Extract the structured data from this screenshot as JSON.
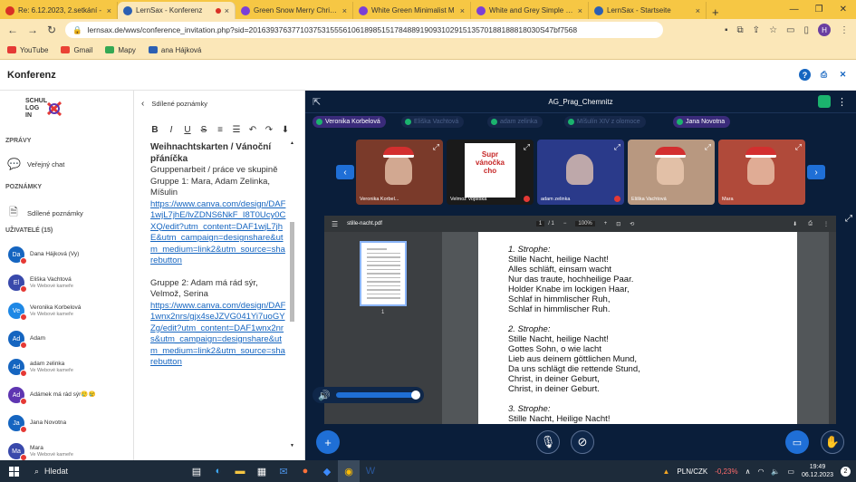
{
  "browser": {
    "tabs": [
      {
        "title": "Re: 6.12.2023, 2.setkání - ",
        "favicon_color": "#d93025",
        "active": false
      },
      {
        "title": "LernSax - Konferenz",
        "favicon_color": "#2b5fb3",
        "active": true
      },
      {
        "title": "Green Snow Merry Christm",
        "favicon_color": "#7b3fd6",
        "active": false
      },
      {
        "title": "White Green Minimalist M",
        "favicon_color": "#7b3fd6",
        "active": false
      },
      {
        "title": "White and Grey Simple Fa",
        "favicon_color": "#7b3fd6",
        "active": false
      },
      {
        "title": "LernSax - Startseite",
        "favicon_color": "#2b5fb3",
        "active": false
      }
    ],
    "new_tab_label": "+",
    "url": "lernsax.de/wws/conference_invitation.php?sid=20163937637710375315556106189851517848891909310291513570188188818030S47bf7568",
    "profile_initial": "H",
    "bookmarks": [
      {
        "label": "YouTube",
        "color": "#e53935"
      },
      {
        "label": "Gmail",
        "color": "#ea4335"
      },
      {
        "label": "Mapy",
        "color": "#34a853"
      },
      {
        "label": "ana Hájková",
        "color": "#2b5fb3"
      }
    ]
  },
  "app": {
    "title": "Konferenz"
  },
  "sidebar": {
    "logo_text": [
      "SCHUL",
      "LOG",
      "IN"
    ],
    "sections": {
      "messages": "ZPRÁVY",
      "notes": "POZNÁMKY",
      "users": "UŽIVATELÉ (15)"
    },
    "items": {
      "public_chat": "Veřejný chat",
      "shared_notes": "Sdílené poznámky"
    },
    "users": [
      {
        "initials": "Da",
        "name": "Dana Hájková (Vy)",
        "sub": "",
        "color": "#1565c0"
      },
      {
        "initials": "El",
        "name": "Eliška Vachtová",
        "sub": "Ve Webové kameře",
        "color": "#3949ab"
      },
      {
        "initials": "Ve",
        "name": "Veronika Korbelová",
        "sub": "Ve Webové kameře",
        "color": "#1e88e5"
      },
      {
        "initials": "Ad",
        "name": "Adam",
        "sub": "",
        "color": "#1565c0"
      },
      {
        "initials": "Ad",
        "name": "adam zelinka",
        "sub": "Ve Webové kameře",
        "color": "#1565c0"
      },
      {
        "initials": "Ad",
        "name": "Adámek má rád sýr🥲😢",
        "sub": "",
        "color": "#5e35b1"
      },
      {
        "initials": "Ja",
        "name": "Jana Novotna",
        "sub": "",
        "color": "#1565c0"
      },
      {
        "initials": "Ma",
        "name": "Mara",
        "sub": "Ve Webové kameře",
        "color": "#3949ab"
      }
    ]
  },
  "notes": {
    "title": "Sdílené poznámky",
    "toolbar": [
      "B",
      "I",
      "U",
      "S",
      "≡",
      "☰",
      "↶",
      "↷",
      "⬇"
    ],
    "heading": "Weihnachtskarten / Vánoční přáníčka",
    "line1": "Gruppenarbeit / práce ve skupině",
    "group1": "Gruppe 1: Mara, Adam Zelinka, Míšulin",
    "link1": "https://www.canva.com/design/DAF1wjL7jhE/lvZDNS6NkF_I8T0Ucy0CXQ/edit?utm_content=DAF1wjL7jhE&utm_campaign=designshare&utm_medium=link2&utm_source=sharebutton",
    "group2": "Gruppe 2: Adam má rád sýr, Velmož, Serina",
    "link2": "https://www.canva.com/design/DAF1wnx2nrs/gjx4seJZVG041Yi7uoGYZg/edit?utm_content=DAF1wnx2nrs&utm_campaign=designshare&utm_medium=link2&utm_source=sharebutton"
  },
  "conference": {
    "room": "AG_Prag_Chemnitz",
    "participants_chips": [
      {
        "name": "Veronika Korbelová",
        "active": true
      },
      {
        "name": "Eliška Vachtová",
        "active": false
      },
      {
        "name": "adam zelinka",
        "active": false
      },
      {
        "name": "Míšulín XIV z olomoce",
        "active": false
      },
      {
        "name": "Jana Novotna",
        "active": true
      }
    ],
    "videos": [
      {
        "label": "Veronika Korbel...",
        "bg": "#7a3a2a",
        "muted": false
      },
      {
        "label": "Velmož Vojtěška",
        "bg": "#1a1a1a",
        "muted": true
      },
      {
        "label": "adam zelinka",
        "bg": "#2a3a8a",
        "muted": true
      },
      {
        "label": "Eliška Vachtová",
        "bg": "#b89880",
        "muted": false
      },
      {
        "label": "Mara",
        "bg": "#b04a3a",
        "muted": false
      }
    ],
    "card_text": [
      "Supr",
      "vánočka",
      "cho"
    ],
    "pdf": {
      "filename": "stille-nacht.pdf",
      "page_current": "1",
      "page_total": "/ 1",
      "zoom": "100%",
      "thumb_page": "1",
      "stanzas": [
        {
          "title": "1. Strophe:",
          "lines": [
            "Stille Nacht, heilige Nacht!",
            "Alles schläft, einsam wacht",
            "Nur das traute, hochheilige Paar.",
            "Holder Knabe im lockigen Haar,",
            "Schlaf in himmlischer Ruh,",
            "Schlaf in himmlischer Ruh."
          ]
        },
        {
          "title": "2. Strophe:",
          "lines": [
            "Stille Nacht, heilige Nacht!",
            "Gottes Sohn, o wie lacht",
            "Lieb aus deinem göttlichen Mund,",
            "Da uns schlägt die rettende Stund,",
            "Christ, in deiner Geburt,",
            "Christ, in deiner Geburt."
          ]
        },
        {
          "title": "3. Strophe:",
          "lines": [
            "Stille Nacht, Heilige Nacht!"
          ]
        }
      ]
    },
    "volume_level": 1.0
  },
  "taskbar": {
    "search_label": "Hledat",
    "currency": "PLN/CZK",
    "change": "-0,23%",
    "time": "19:49",
    "date": "06.12.2023",
    "notifications": "2"
  }
}
